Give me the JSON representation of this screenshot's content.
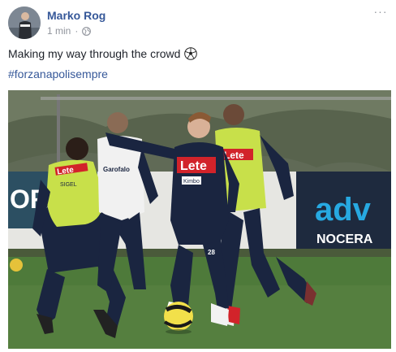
{
  "post": {
    "author": "Marko Rog",
    "timestamp": "1 min",
    "separator": "·",
    "privacy_icon": "globe-icon",
    "menu_icon": "more-options-icon",
    "more_label": "···",
    "message": "Making my way through the crowd",
    "message_emoji": "soccer-ball-icon",
    "hashtag": "#forzanapolisempre"
  },
  "photo": {
    "description_icon": "training-photo",
    "kit_sponsor": "Lete",
    "back_sponsor": "Lete",
    "bib_text": "SIGEL",
    "sleeve_text": "Kimbo",
    "jersey_number": "28",
    "shirt_sponsor_small": "Garofalo",
    "background_board": "adv",
    "background_board_sub": "NOCERA",
    "left_board": "OR"
  },
  "colors": {
    "link": "#365899",
    "meta": "#90949c",
    "napoli_navy": "#1a2540",
    "bib_yellow": "#c8e04a",
    "sponsor_red": "#d2232a"
  }
}
